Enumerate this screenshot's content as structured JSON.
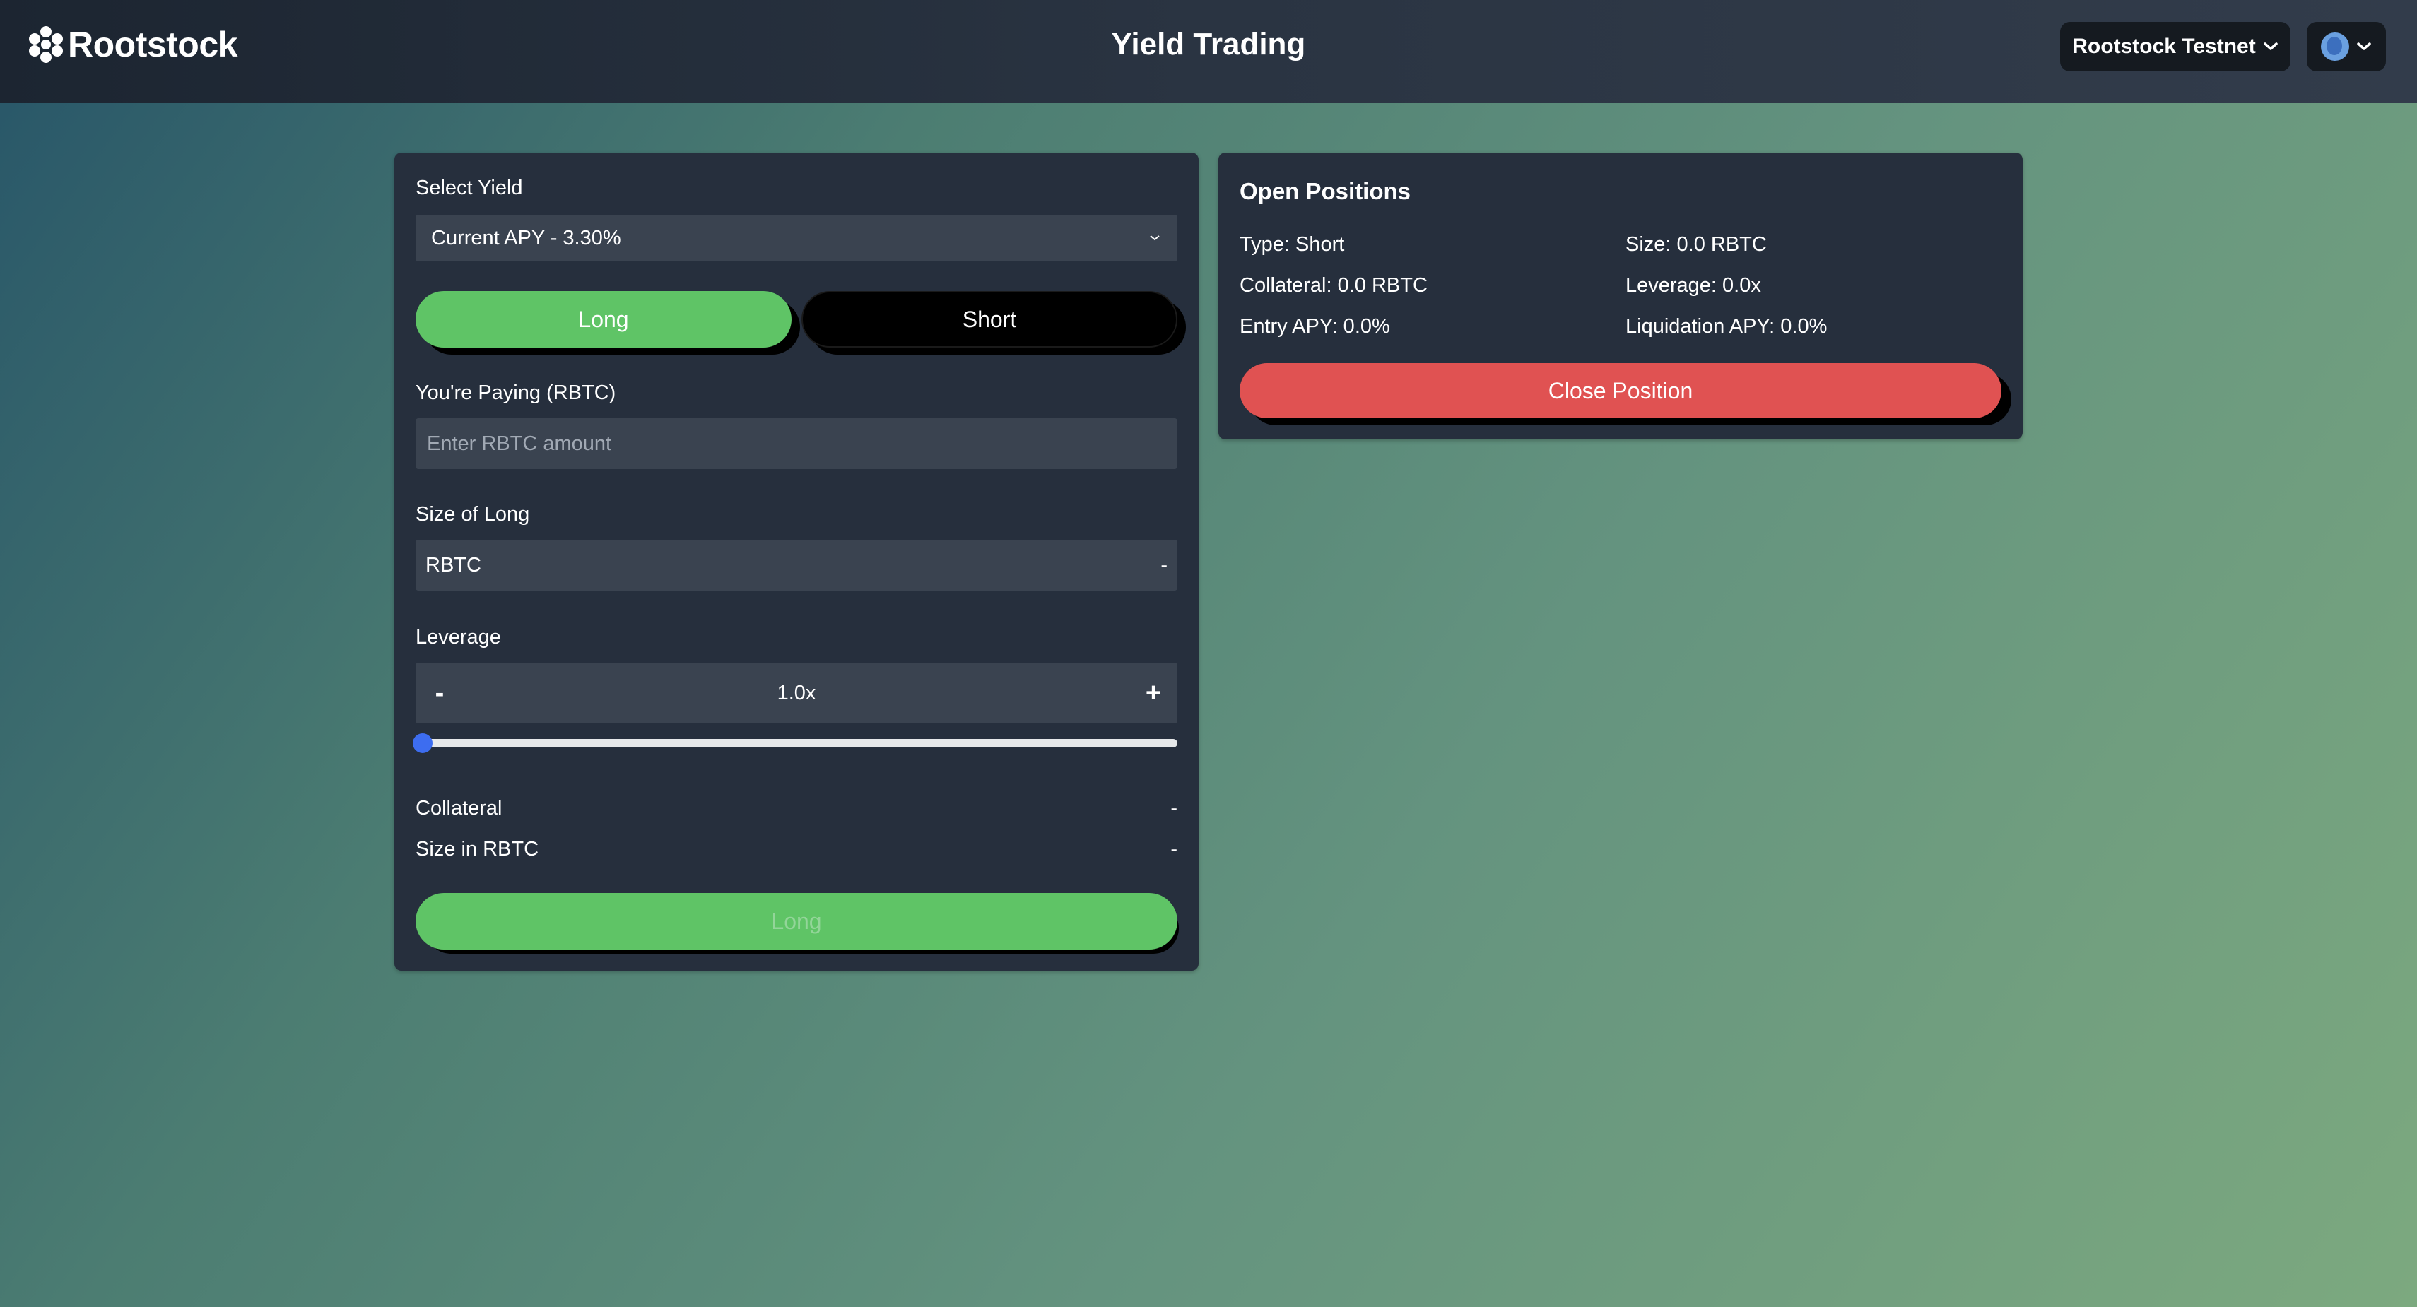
{
  "header": {
    "brand": "Rootstock",
    "title": "Yield Trading",
    "network_label": "Rootstock Testnet"
  },
  "trade": {
    "select_yield_label": "Select Yield",
    "selected_yield": "Current APY - 3.30%",
    "long_tab": "Long",
    "short_tab": "Short",
    "paying_label": "You're Paying (RBTC)",
    "paying_placeholder": "Enter RBTC amount",
    "size_label": "Size of Long",
    "size_unit": "RBTC",
    "size_value": "-",
    "leverage_label": "Leverage",
    "leverage_minus": "-",
    "leverage_value": "1.0x",
    "leverage_plus": "+",
    "leverage_slider_fraction": 0,
    "collateral_label": "Collateral",
    "collateral_value": "-",
    "size_rbtc_label": "Size in RBTC",
    "size_rbtc_value": "-",
    "submit_label": "Long"
  },
  "positions": {
    "title": "Open Positions",
    "type": "Type: Short",
    "size": "Size: 0.0 RBTC",
    "collateral": "Collateral: 0.0 RBTC",
    "leverage": "Leverage: 0.0x",
    "entry_apy": "Entry APY: 0.0%",
    "liquidation_apy": "Liquidation APY: 0.0%",
    "close_label": "Close Position"
  },
  "colors": {
    "long_green": "#5fc466",
    "close_red": "#e05252",
    "panel_bg": "#262f3d",
    "slider_blue": "#3d6df0"
  }
}
